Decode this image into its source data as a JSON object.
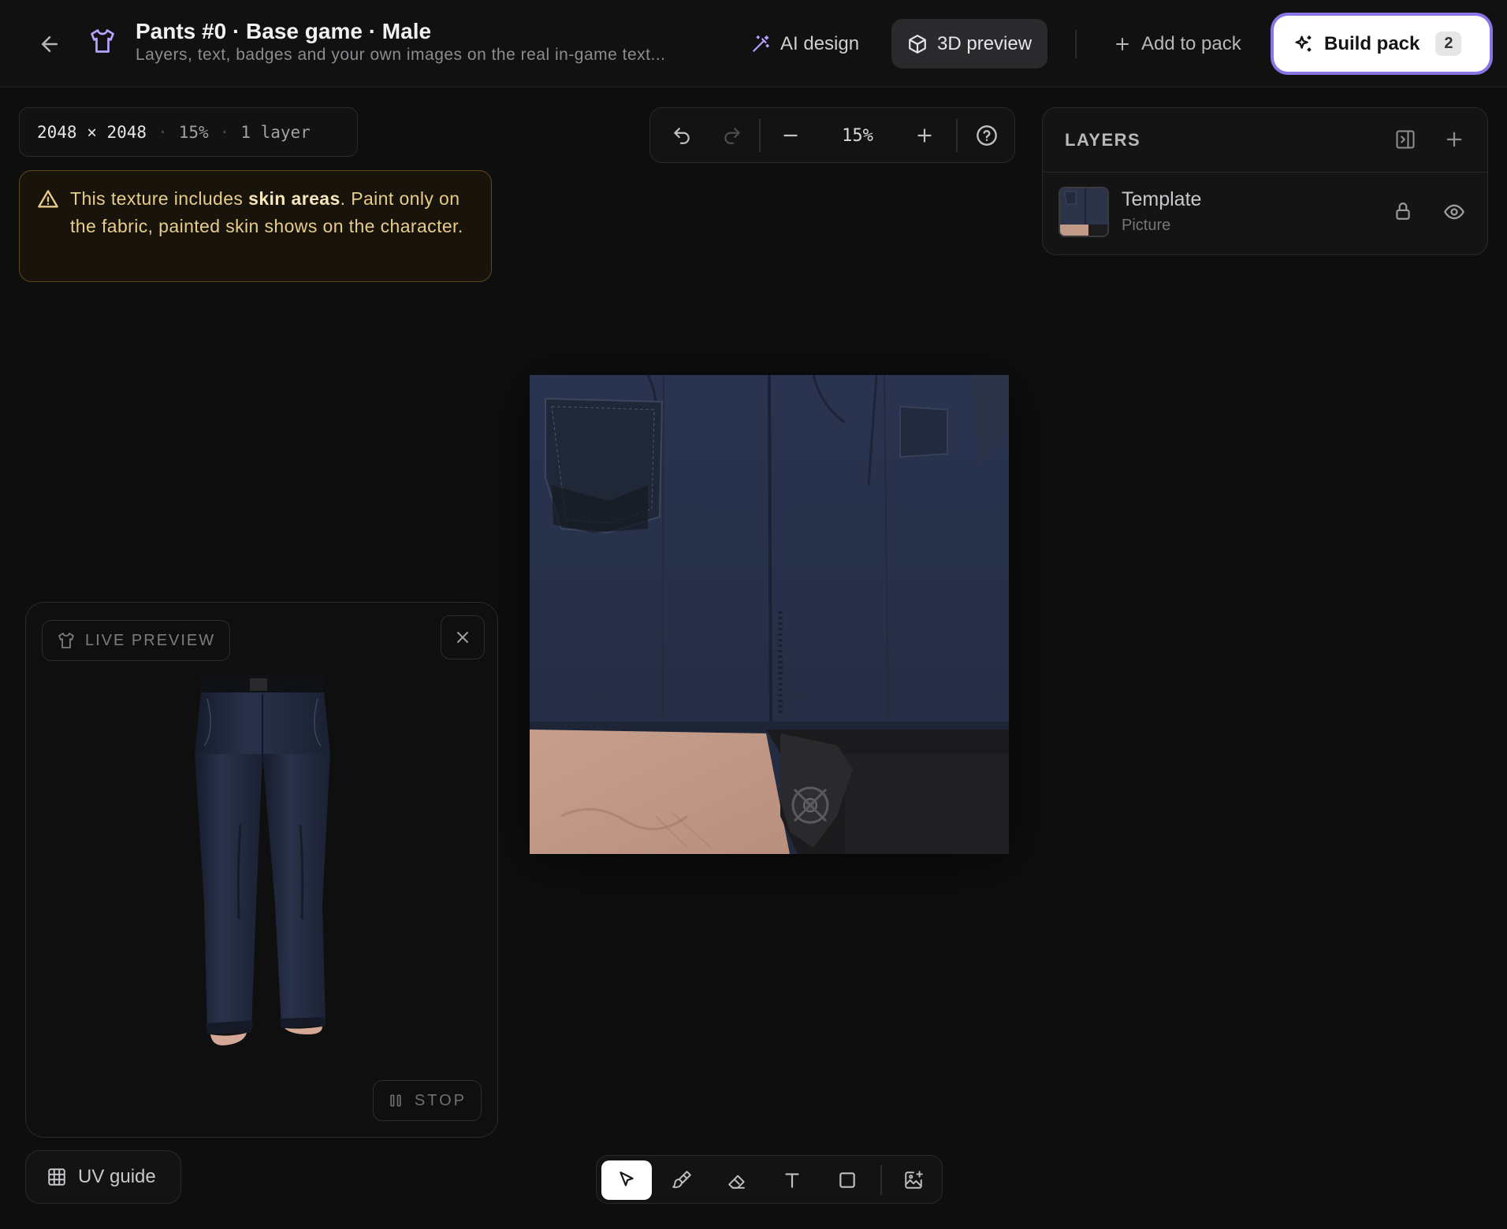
{
  "header": {
    "title": "Pants #0 · Base game · Male",
    "subtitle": "Layers, text, badges and your own images on the real in-game text...",
    "ai_design_label": "AI design",
    "preview_label": "3D preview",
    "add_label": "Add to pack",
    "build_label": "Build pack",
    "build_count": "2"
  },
  "canvas_info": {
    "dimensions": "2048 × 2048",
    "zoom": "15%",
    "layers": "1 layer"
  },
  "warning": {
    "prefix": "This texture includes ",
    "strong": "skin areas",
    "suffix": ". Paint only on the fabric, painted skin shows on the character."
  },
  "zoom_toolbar": {
    "level": "15%"
  },
  "layers_panel": {
    "title": "LAYERS",
    "items": [
      {
        "name": "Template",
        "type": "Picture"
      }
    ]
  },
  "live_preview": {
    "label": "LIVE PREVIEW",
    "stop_label": "STOP"
  },
  "uv_guide": {
    "label": "UV guide"
  },
  "tools": [
    "select-tool",
    "brush-tool",
    "eraser-tool",
    "text-tool",
    "rectangle-tool",
    "image-tool"
  ],
  "colors": {
    "accent": "#8a74e6",
    "warning_text": "#e8cd8a",
    "denim": "#283248",
    "skin": "#c29a88"
  }
}
